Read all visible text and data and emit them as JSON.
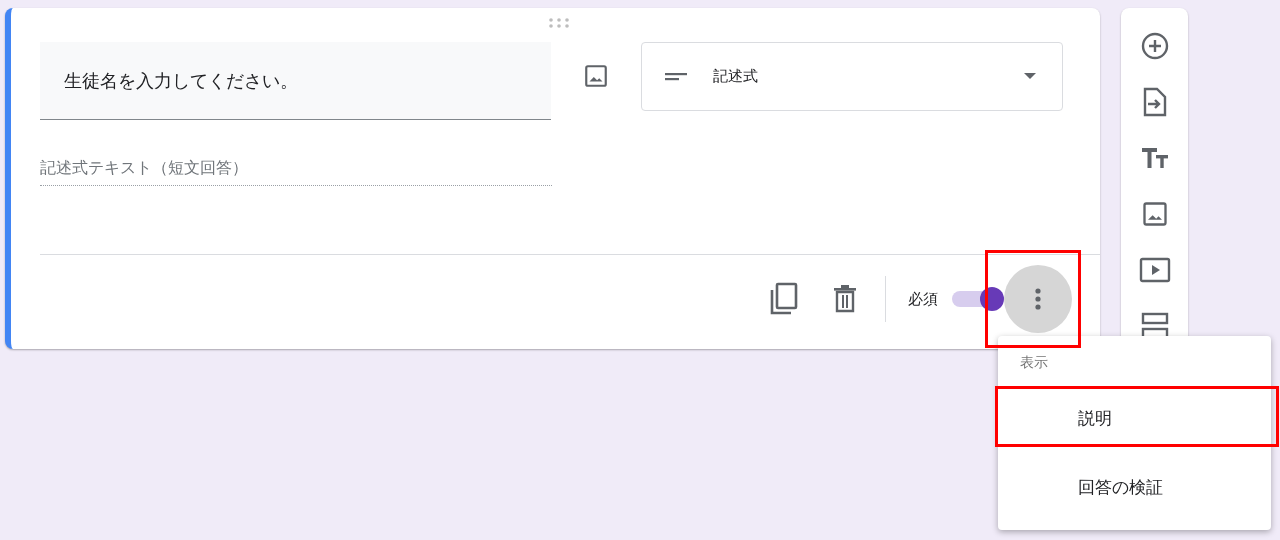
{
  "question": {
    "title": "生徒名を入力してください。"
  },
  "question_type": {
    "label": "記述式"
  },
  "answer": {
    "placeholder": "記述式テキスト（短文回答）"
  },
  "footer": {
    "required_label": "必須",
    "required": true,
    "more_button_highlighted": true
  },
  "menu": {
    "header": "表示",
    "items": [
      {
        "label": "説明",
        "highlighted": true
      },
      {
        "label": "回答の検証",
        "highlighted": false
      }
    ]
  }
}
